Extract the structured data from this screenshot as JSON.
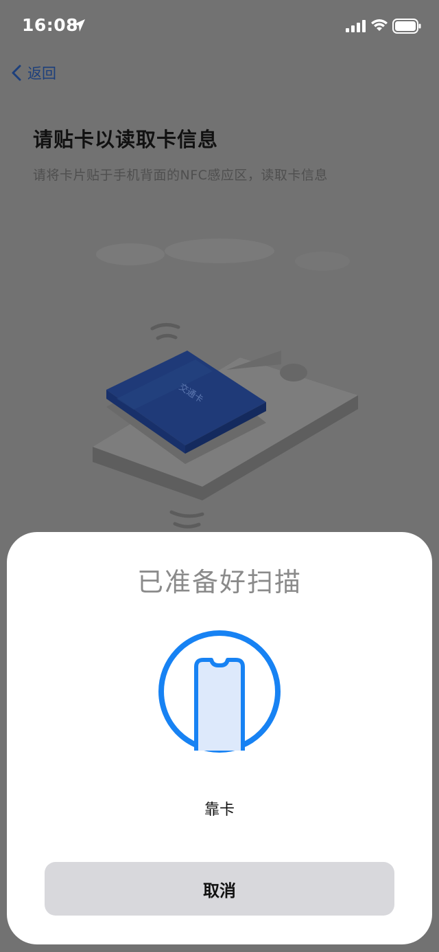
{
  "status_bar": {
    "time": "16:08"
  },
  "nav": {
    "back_label": "返回"
  },
  "page": {
    "title": "请贴卡以读取卡信息",
    "subtitle": "请将卡片贴于手机背面的NFC感应区，读取卡信息",
    "card_label": "交通卡"
  },
  "sheet": {
    "title": "已准备好扫描",
    "hint": "靠卡",
    "cancel_label": "取消"
  },
  "colors": {
    "accent": "#1782f3",
    "card": "#1f3a78",
    "dim_background": "#727272"
  }
}
